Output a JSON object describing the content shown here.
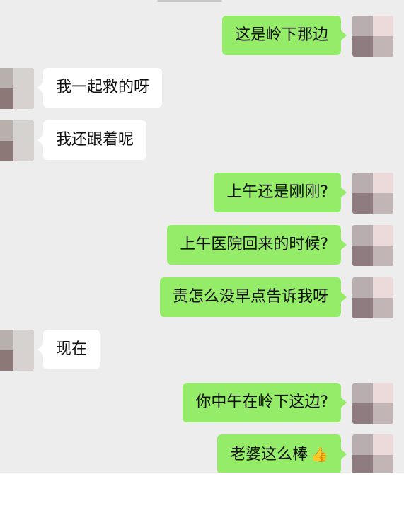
{
  "messages": [
    {
      "id": "m1",
      "side": "right",
      "text": "这是岭下那边",
      "avatar_colors": [
        "#b9aeaf",
        "#ecd9d9",
        "#8f7c80",
        "#c1b5b6"
      ]
    },
    {
      "id": "m2",
      "side": "left",
      "text": "我一起救的呀",
      "avatar_colors": [
        "#b8b0ad",
        "#d6d2cf",
        "#8c7876",
        "#d7d2cf"
      ]
    },
    {
      "id": "m3",
      "side": "left",
      "text": "我还跟着呢",
      "avatar_colors": [
        "#b8b0ad",
        "#d6d2cf",
        "#8c7876",
        "#d7d2cf"
      ]
    },
    {
      "id": "m4",
      "side": "right",
      "text": "上午还是刚刚?",
      "avatar_colors": [
        "#b9aeaf",
        "#ecd9d9",
        "#8f7c80",
        "#c1b5b6"
      ]
    },
    {
      "id": "m5",
      "side": "right",
      "text": "上午医院回来的时候?",
      "avatar_colors": [
        "#b9aeaf",
        "#ecd9d9",
        "#8f7c80",
        "#c1b5b6"
      ]
    },
    {
      "id": "m6",
      "side": "right",
      "text": "责怎么没早点告诉我呀",
      "avatar_colors": [
        "#b9aeaf",
        "#ecd9d9",
        "#8f7c80",
        "#c1b5b6"
      ]
    },
    {
      "id": "m7",
      "side": "left",
      "text": "现在",
      "avatar_colors": [
        "#b8b0ad",
        "#d6d2cf",
        "#8c7876",
        "#d7d2cf"
      ]
    },
    {
      "id": "m8",
      "side": "right",
      "text": "你中午在岭下这边?",
      "avatar_colors": [
        "#b9aeaf",
        "#ecd9d9",
        "#8f7c80",
        "#c1b5b6"
      ]
    },
    {
      "id": "m9",
      "side": "right",
      "text": "老婆这么棒",
      "emoji": "👍",
      "avatar_colors": [
        "#b9aeaf",
        "#ecd9d9",
        "#8f7c80",
        "#c1b5b6"
      ]
    }
  ],
  "colors": {
    "background": "#ededed",
    "bubble_self": "#95ec69",
    "bubble_other": "#ffffff"
  },
  "icons": {
    "thumbs_up": "thumbs-up-icon"
  }
}
